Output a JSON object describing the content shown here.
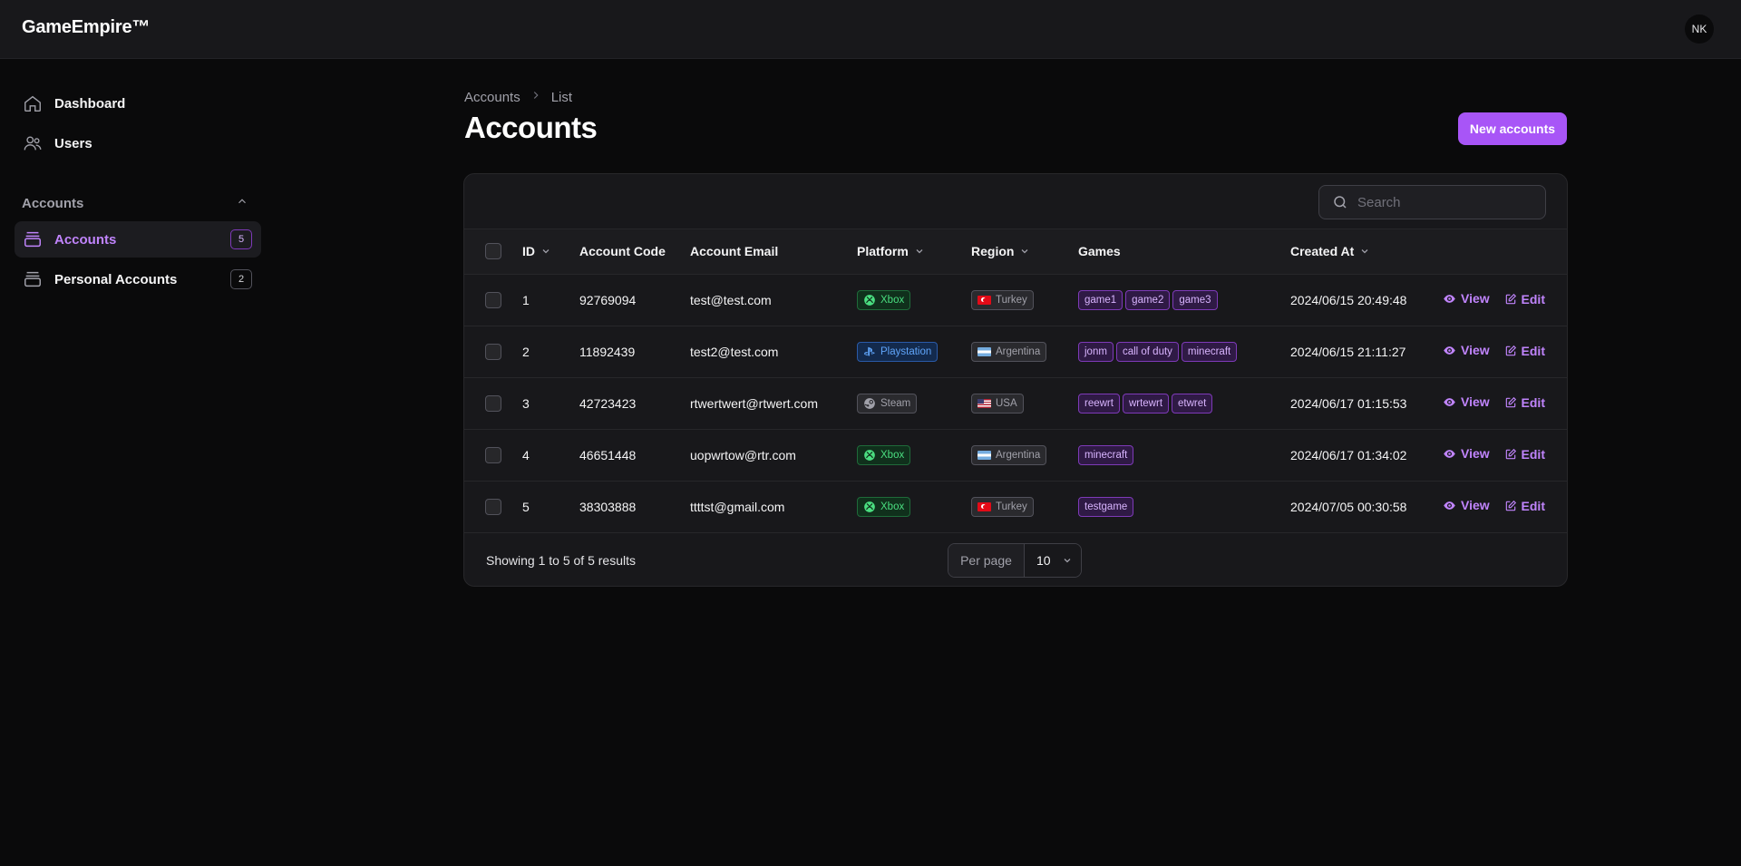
{
  "app": {
    "brand": "GameEmpire™",
    "avatar_initials": "NK"
  },
  "sidebar": {
    "items": [
      {
        "label": "Dashboard",
        "icon": "home-icon"
      },
      {
        "label": "Users",
        "icon": "users-icon"
      }
    ],
    "group": {
      "label": "Accounts",
      "items": [
        {
          "label": "Accounts",
          "count": "5",
          "active": true
        },
        {
          "label": "Personal Accounts",
          "count": "2",
          "active": false
        }
      ]
    }
  },
  "breadcrumb": {
    "root": "Accounts",
    "current": "List"
  },
  "page": {
    "title": "Accounts",
    "new_button": "New accounts"
  },
  "search": {
    "placeholder": "Search"
  },
  "table": {
    "headers": {
      "id": "ID",
      "code": "Account Code",
      "email": "Account Email",
      "platform": "Platform",
      "region": "Region",
      "games": "Games",
      "created": "Created At"
    },
    "actions": {
      "view": "View",
      "edit": "Edit"
    },
    "rows": [
      {
        "id": "1",
        "code": "92769094",
        "email": "test@test.com",
        "platform": "Xbox",
        "region": "Turkey",
        "games": [
          "game1",
          "game2",
          "game3"
        ],
        "created": "2024/06/15 20:49:48"
      },
      {
        "id": "2",
        "code": "11892439",
        "email": "test2@test.com",
        "platform": "Playstation",
        "region": "Argentina",
        "games": [
          "jonm",
          "call of duty",
          "minecraft"
        ],
        "created": "2024/06/15 21:11:27"
      },
      {
        "id": "3",
        "code": "42723423",
        "email": "rtwertwert@rtwert.com",
        "platform": "Steam",
        "region": "USA",
        "games": [
          "reewrt",
          "wrtewrt",
          "etwret"
        ],
        "created": "2024/06/17 01:15:53"
      },
      {
        "id": "4",
        "code": "46651448",
        "email": "uopwrtow@rtr.com",
        "platform": "Xbox",
        "region": "Argentina",
        "games": [
          "minecraft"
        ],
        "created": "2024/06/17 01:34:02"
      },
      {
        "id": "5",
        "code": "38303888",
        "email": "ttttst@gmail.com",
        "platform": "Xbox",
        "region": "Turkey",
        "games": [
          "testgame"
        ],
        "created": "2024/07/05 00:30:58"
      }
    ]
  },
  "footer": {
    "showing": "Showing 1 to 5 of 5 results",
    "per_page_label": "Per page",
    "per_page_value": "10"
  },
  "colors": {
    "accent": "#a855f7",
    "background": "#0a0a0b",
    "surface": "#18181b",
    "xbox": "#4ade80",
    "playstation": "#60a5fa"
  }
}
